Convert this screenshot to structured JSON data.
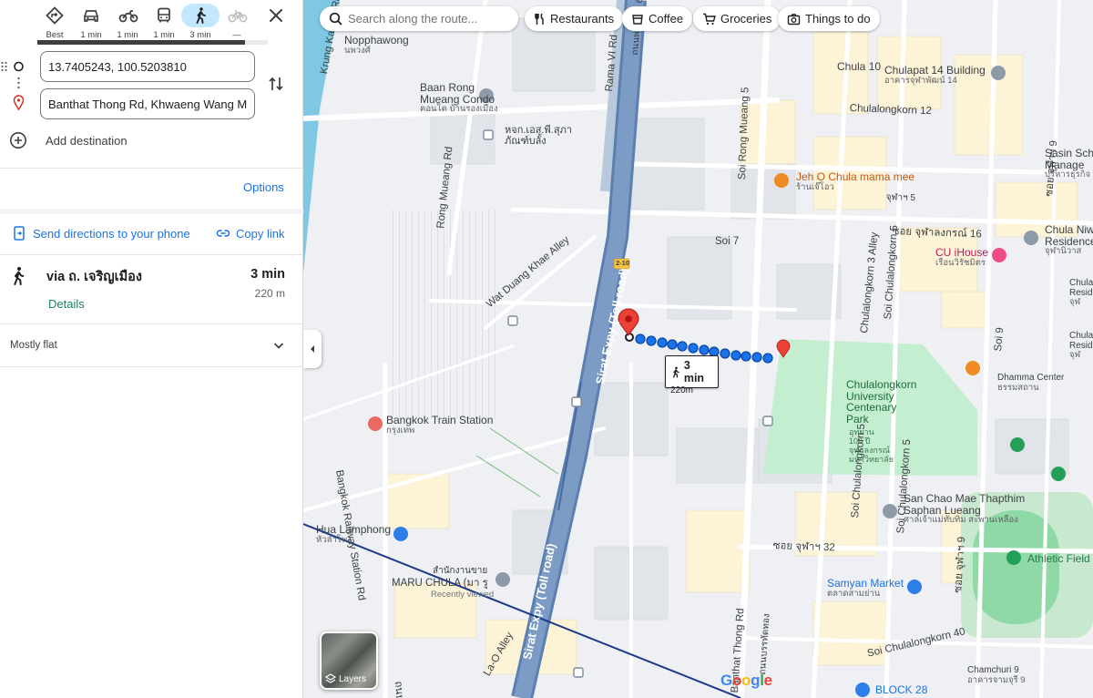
{
  "travel_modes": [
    {
      "name": "best",
      "label": "Best",
      "active": false
    },
    {
      "name": "driving",
      "label": "1 min",
      "active": false
    },
    {
      "name": "motorcycle",
      "label": "1 min",
      "active": false
    },
    {
      "name": "transit",
      "label": "1 min",
      "active": false
    },
    {
      "name": "walking",
      "label": "3 min",
      "active": true
    },
    {
      "name": "cycling",
      "label": "—",
      "active": false
    }
  ],
  "progress": {
    "fraction": 0.9
  },
  "origin": {
    "value": "13.7405243, 100.5203810"
  },
  "destination": {
    "value": "Banthat Thong Rd, Khwaeng Wang Mai, Pathum Wan, Bangkok"
  },
  "add_destination": "Add destination",
  "options": "Options",
  "send_to_phone": "Send directions to your phone",
  "copy_link": "Copy link",
  "route": {
    "via": "via ถ. เจริญเมือง",
    "time": "3 min",
    "distance": "220 m",
    "details": "Details"
  },
  "elevation": "Mostly flat",
  "map": {
    "search_placeholder": "Search along the route...",
    "chips": {
      "restaurants": "Restaurants",
      "coffee": "Coffee",
      "groceries": "Groceries",
      "things_to_do": "Things to do"
    },
    "bubble": {
      "time": "3 min",
      "distance": "220m"
    },
    "layers": "Layers",
    "labels": {
      "nopphawong": "Nopphawong",
      "nopphawong_th": "นพวงศ์",
      "baan_rong": "Baan Rong",
      "mueang_condo": "Mueang Condo",
      "condo_th": "คอนโด บ้านรองเมือง",
      "hq_th1": "หจก.เอส.พี.สุภา",
      "hq_th2": "ภัณฑ์บลั้ง",
      "chula10": "Chula 10",
      "chulapat": "Chulapat 14 Building",
      "chulapat_th": "อาคารจุฬาพัฒน์ 14",
      "jeh_o": "Jeh O Chula mama mee",
      "jeh_o_th": "ร้านเจ๊โอว",
      "sasin1": "Sasin Scho",
      "sasin2": "Manage",
      "sasin3": "บริหารธุรกิจ",
      "chula_niwa": "Chula Niw",
      "chula_niwa2": "Residence",
      "chula_niwa3": "จุฬานิวาส",
      "cu_ihouse": "CU iHouse",
      "cu_ihouse_th": "เรือนวิรัชมิตร",
      "chula_res1": "Chula",
      "chula_res1b": "Reside",
      "chula_res1c": "จุฬ",
      "chula_res2": "Chula",
      "chula_res2b": "Reside",
      "chula_res2c": "จุฬ",
      "dhamma": "Dhamma Center",
      "dhamma_th": "ธรรมสถาน",
      "park1": "Chulalongkorn",
      "park2": "University",
      "park3": "Centenary",
      "park4": "Park",
      "park_th1": "อุทยาน",
      "park_th2": "100 ปี",
      "park_th3": "จุฬาลงกรณ์",
      "park_th4": "มหาวิทยาลัย",
      "train": "Bangkok Train Station",
      "train_th": "กรุงเทพ",
      "hua": "Hua Lamphong",
      "hua_th": "หัวลำโพง",
      "office_th": "สำนักงานขาย",
      "maru": "MARU CHULA (มา รู",
      "recent": "Recently viewed",
      "san_chao1": "San Chao Mae Thapthim",
      "san_chao2": "Saphan Lueang",
      "san_chao_th": "ศาลเจ้าแม่ทับทิม สะพานเหลือง",
      "samyan": "Samyan Market",
      "samyan_th": "ตลาดสามย่าน",
      "athletic": "Athletic Field",
      "chamchuri": "Chamchuri 9",
      "chamchuri_th": "อาคารจามจุรี 9",
      "block28": "BLOCK 28",
      "hwy": "2-10"
    },
    "roads": {
      "krung_kasem": "Krung Kasem Rd",
      "rama6": "Rama VI Rd",
      "rama6_th": "ถนนพระราม 6",
      "rong_mueang": "Rong Mueang Rd",
      "soi_rong_mueang5": "Soi Rong Mueang 5",
      "wat_duang": "Wat Duang Khae Alley",
      "sirat1": "Sirat Expy (Toll road)",
      "sirat2": "Sirat Expy (Toll road)",
      "bkk_railway": "Bangkok Railway Station Rd",
      "soi7": "Soi 7",
      "chula3": "Chulalongkorn 3 Alley",
      "soi_chula5": "Soi Chulalongkorn 5",
      "soi_chula5b": "Soi Chulalongkorn 5",
      "chula16": "ซอย จุฬาลงกรณ์ 16",
      "chula12": "Chulalongkorn 12",
      "chula40": "Soi Chulalongkorn 40",
      "chula32": "ซอย จุฬาฯ 32",
      "chula_th5": "จุฬาฯ 5",
      "soi9": "Soi 9",
      "soi9b": "ซอย จุฬาฯ 9",
      "soi9c": "ซอย จุฬาฯ 9",
      "soi_chula_top": "ซอย จุฬาฯ 9",
      "banthat": "Banthat Thong Rd",
      "banthat_th": "ถนนบรรทัดทอง",
      "lao": "La-O Alley",
      "thanon_th": "ถนน",
      "chula_khorn5": "Soi Chulalongkorn 5"
    }
  }
}
